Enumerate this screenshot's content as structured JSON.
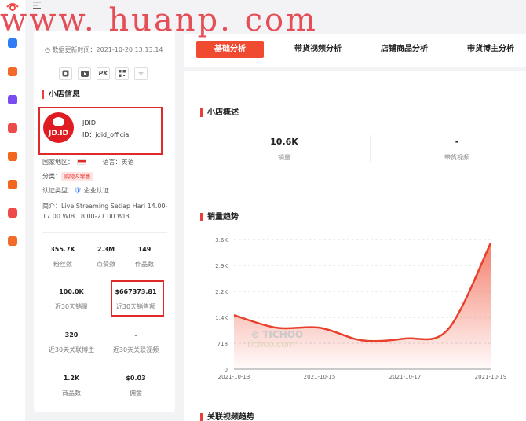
{
  "watermark": "www. huanp. com",
  "colors": {
    "accent": "#f04a30",
    "line": "#e8402a"
  },
  "rail": {
    "logo_icon": "eye-logo-icon",
    "menu_icon": "menu-icon",
    "items": [
      {
        "icon": "chat-icon",
        "color": "#2f7cf6"
      },
      {
        "icon": "mail-icon",
        "color": "#f36b2b"
      },
      {
        "icon": "search-circle-icon",
        "color": "#7b4cf0"
      },
      {
        "icon": "rocket-icon",
        "color": "#ef4a4a"
      },
      {
        "icon": "record-icon",
        "color": "#f3661e"
      },
      {
        "icon": "briefcase-icon",
        "color": "#f3661e"
      },
      {
        "icon": "heart-icon",
        "color": "#ef4a4a"
      },
      {
        "icon": "diamond-icon",
        "color": "#f36b2b"
      }
    ]
  },
  "left": {
    "update_text": "数据更新时间：2021-10-20 13:13:14",
    "tools": [
      "instagram-icon",
      "youtube-icon",
      "PK",
      "qr-code-icon",
      "star-icon"
    ],
    "shop_section": "小店信息",
    "shop": {
      "logo_text": "JD.ID",
      "name": "JDID",
      "id_text": "ID：jdid_official"
    },
    "region_label": "国家地区：",
    "language_label": "语言：",
    "language": "英语",
    "category_label": "分类：",
    "category": "购物&零售",
    "cert_label": "认证类型：",
    "cert": "企业认证",
    "intro_label": "简介：",
    "intro": "Live Streaming Setiap Hari 14.00-17.00 WIB 18.00-21.00 WIB",
    "stats": [
      {
        "value": "355.7K",
        "label": "粉丝数"
      },
      {
        "value": "2.3M",
        "label": "点赞数"
      },
      {
        "value": "149",
        "label": "作品数"
      },
      {
        "value": "100.0K",
        "label": "近30天销量"
      },
      {
        "value": "$667373.81",
        "label": "近30天销售额"
      },
      {
        "value": "320",
        "label": "近30天关联博主"
      },
      {
        "value": "-",
        "label": "近30天关联视频"
      },
      {
        "value": "1.2K",
        "label": "商品数"
      },
      {
        "value": "$0.03",
        "label": "佣金"
      }
    ]
  },
  "tabs": [
    "基础分析",
    "带货视频分析",
    "店铺商品分析",
    "带货博主分析"
  ],
  "overview": {
    "title": "小店概述",
    "sales_value": "10.6K",
    "sales_label": "销量",
    "videos_value": "-",
    "videos_label": "带货视频"
  },
  "trend_title": "销量趋势",
  "related_title": "关联视频趋势",
  "chart_watermark": {
    "brand": "TICHOO",
    "domain": "tichoo.com"
  },
  "chart_data": {
    "type": "area",
    "title": "销量趋势",
    "xlabel": "",
    "ylabel": "",
    "x": [
      "2021-10-13",
      "2021-10-14",
      "2021-10-15",
      "2021-10-16",
      "2021-10-17",
      "2021-10-18",
      "2021-10-19"
    ],
    "series": [
      {
        "values": [
          1500,
          1150,
          1150,
          800,
          850,
          1100,
          3500
        ]
      }
    ],
    "x_ticks": [
      "2021-10-13",
      "2021-10-15",
      "2021-10-17",
      "2021-10-19"
    ],
    "y_ticks": [
      "0",
      "718",
      "1.4K",
      "2.2K",
      "2.9K",
      "3.6K"
    ],
    "ylim": [
      0,
      3600
    ],
    "grid": true
  }
}
